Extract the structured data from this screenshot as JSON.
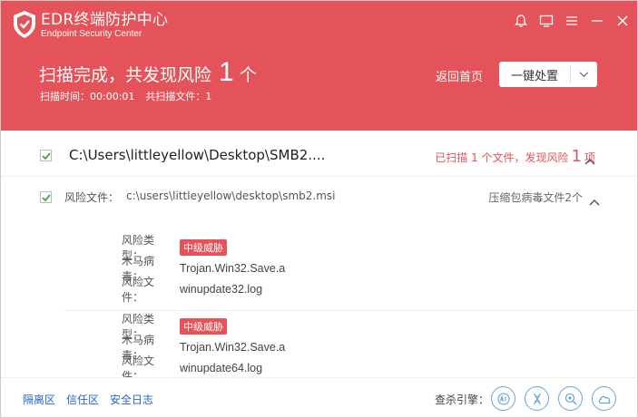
{
  "app": {
    "title": "EDR终端防护中心",
    "subtitle": "Endpoint Security Center"
  },
  "colors": {
    "accent": "#e5535a",
    "link": "#2a64c8",
    "check": "#3aa845"
  },
  "header": {
    "result_prefix": "扫描完成，共发现风险",
    "result_count": "1",
    "result_suffix": "个",
    "scan_time": "扫描时间：00:00:01",
    "scanned_files": "共扫描文件：1",
    "home_link": "返回首页",
    "action_button": "一键处置"
  },
  "scan_item": {
    "path": "C:\\Users\\littleyellow\\Desktop\\SMB2....",
    "summary_prefix": "已扫描 1 个文件，发现风险",
    "summary_count": "1",
    "summary_suffix": "项"
  },
  "risk_file": {
    "label": "风险文件：",
    "path": "c:\\users\\littleyellow\\desktop\\smb2.msi",
    "type": "压缩包病毒文件2个"
  },
  "threats": [
    {
      "risk_type_label": "风险类型：",
      "risk_level": "中级威胁",
      "trojan_label": "木马病毒：",
      "trojan_name": "Trojan.Win32.Save.a",
      "file_label": "风险文件：",
      "file_name": "winupdate32.log"
    },
    {
      "risk_type_label": "风险类型：",
      "risk_level": "中级威胁",
      "trojan_label": "木马病毒：",
      "trojan_name": "Trojan.Win32.Save.a",
      "file_label": "风险文件：",
      "file_name": "winupdate64.log"
    }
  ],
  "footer": {
    "links": [
      "隔离区",
      "信任区",
      "安全日志"
    ],
    "engine_label": "查杀引擎：",
    "engine_icons": [
      "ai-engine-icon",
      "dna-engine-icon",
      "heuristic-engine-icon",
      "cloud-engine-icon"
    ]
  }
}
